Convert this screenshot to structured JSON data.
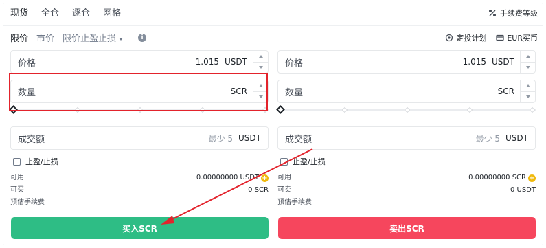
{
  "tabs": [
    "现货",
    "全仓",
    "逐仓",
    "网格"
  ],
  "fee_level": "手续费等级",
  "order_types": {
    "limit": "限价",
    "market": "市价",
    "stop_limit": "限价止盈止损"
  },
  "tools": {
    "auto_invest": "定投计划",
    "eur_buy": "EUR买币"
  },
  "buy": {
    "price": {
      "label": "价格",
      "value": "1.015",
      "unit": "USDT"
    },
    "amount": {
      "label": "数量",
      "value": "",
      "unit": "SCR"
    },
    "total": {
      "label": "成交额",
      "placeholder": "最少 5",
      "unit": "USDT"
    },
    "tp_sl": "止盈/止损",
    "available_label": "可用",
    "available_value": "0.00000000 USDT",
    "can_label": "可买",
    "can_value": "0 SCR",
    "fee_label": "预估手续费",
    "button": "买入SCR"
  },
  "sell": {
    "price": {
      "label": "价格",
      "value": "1.015",
      "unit": "USDT"
    },
    "amount": {
      "label": "数量",
      "value": "",
      "unit": "SCR"
    },
    "total": {
      "label": "成交额",
      "placeholder": "最少 5",
      "unit": "USDT"
    },
    "tp_sl": "止盈/止损",
    "available_label": "可用",
    "available_value": "0.00000000 SCR",
    "can_label": "可卖",
    "can_value": "0 USDT",
    "fee_label": "预估手续费",
    "button": "卖出SCR"
  },
  "colors": {
    "buy": "#2ebd85",
    "sell": "#f6465d",
    "highlight": "#e3232c",
    "accent": "#f0b90b"
  }
}
